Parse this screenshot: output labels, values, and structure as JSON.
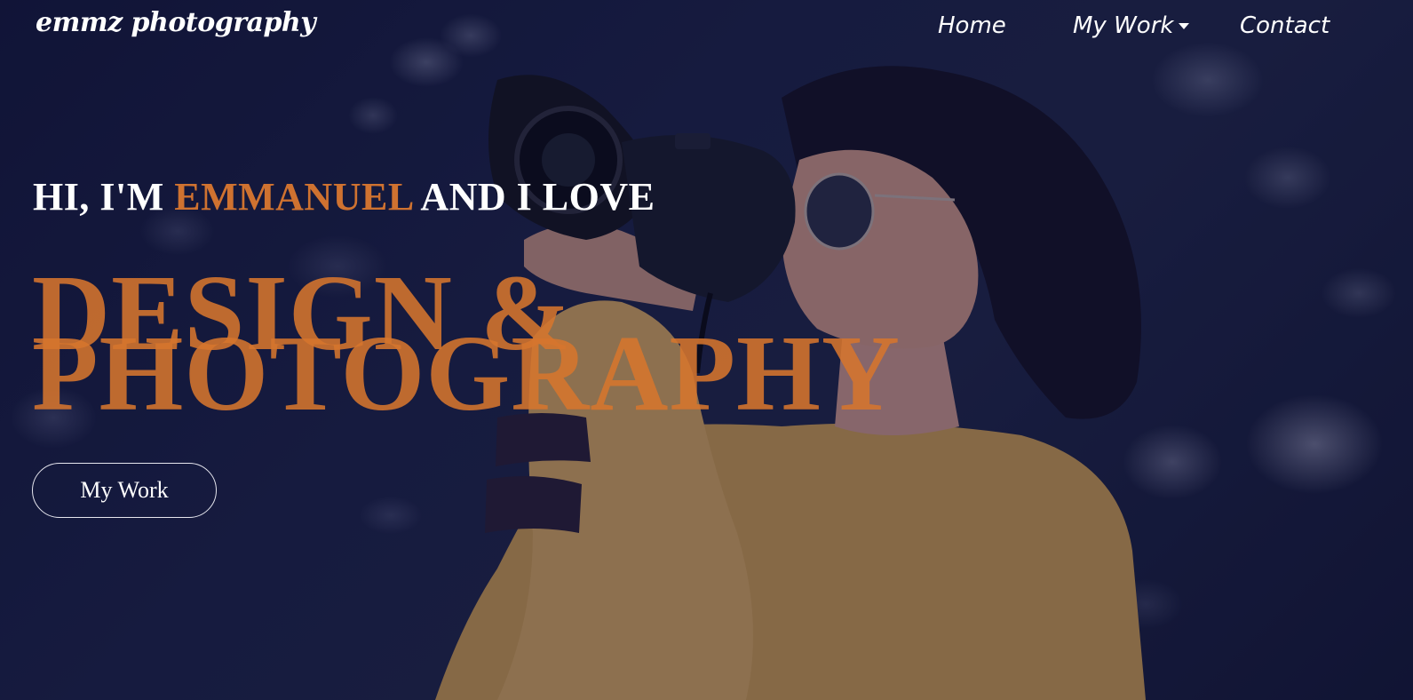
{
  "nav": {
    "brand": "emmz photography",
    "items": [
      {
        "label": "Home"
      },
      {
        "label": "My Work",
        "has_dropdown": true
      },
      {
        "label": "Contact"
      }
    ]
  },
  "hero": {
    "intro_prefix": "HI, I'M",
    "intro_name": "EMMANUEL",
    "intro_suffix": "AND I LOVE",
    "headline_line1": "DESIGN &",
    "headline_line2": "PHOTOGRAPHY",
    "cta_label": "My Work"
  },
  "colors": {
    "accent": "#cf7230",
    "overlay": "#0c0e30",
    "text": "#ffffff"
  },
  "icons": {
    "dropdown": "caret-down-icon"
  }
}
